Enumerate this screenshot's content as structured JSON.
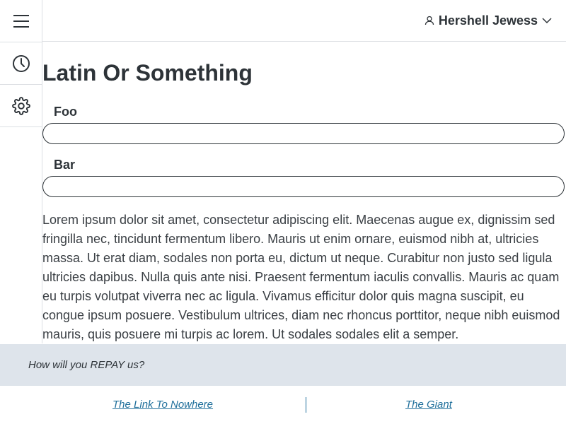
{
  "header": {
    "user_name": "Hershell Jewess"
  },
  "sidebar": {
    "items": [
      {
        "icon": "menu-icon"
      },
      {
        "icon": "clock-icon"
      },
      {
        "icon": "gear-icon"
      }
    ]
  },
  "main": {
    "title": "Latin Or Something",
    "fields": [
      {
        "label": "Foo",
        "value": ""
      },
      {
        "label": "Bar",
        "value": ""
      }
    ],
    "body_text": "Lorem ipsum dolor sit amet, consectetur adipiscing elit. Maecenas augue ex, dignissim sed fringilla nec, tincidunt fermentum libero. Mauris ut enim ornare, euismod nibh at, ultricies massa. Ut erat diam, sodales non porta eu, dictum ut neque. Curabitur non justo sed ligula ultricies dapibus. Nulla quis ante nisi. Praesent fermentum iaculis convallis. Mauris ac quam eu turpis volutpat viverra nec ac ligula. Vivamus efficitur dolor quis magna suscipit, eu congue ipsum posuere. Vestibulum ultrices, diam nec rhoncus porttitor, neque nibh euismod mauris, quis posuere mi turpis ac lorem. Ut sodales sodales elit a semper."
  },
  "banner": {
    "text": "How will you REPAY us?"
  },
  "footer": {
    "links": [
      "The Link To Nowhere",
      "The Giant"
    ]
  },
  "colors": {
    "text": "#2d3338",
    "border": "#dcdfe3",
    "banner_bg": "#dee4eb",
    "link": "#1f6f9b"
  }
}
